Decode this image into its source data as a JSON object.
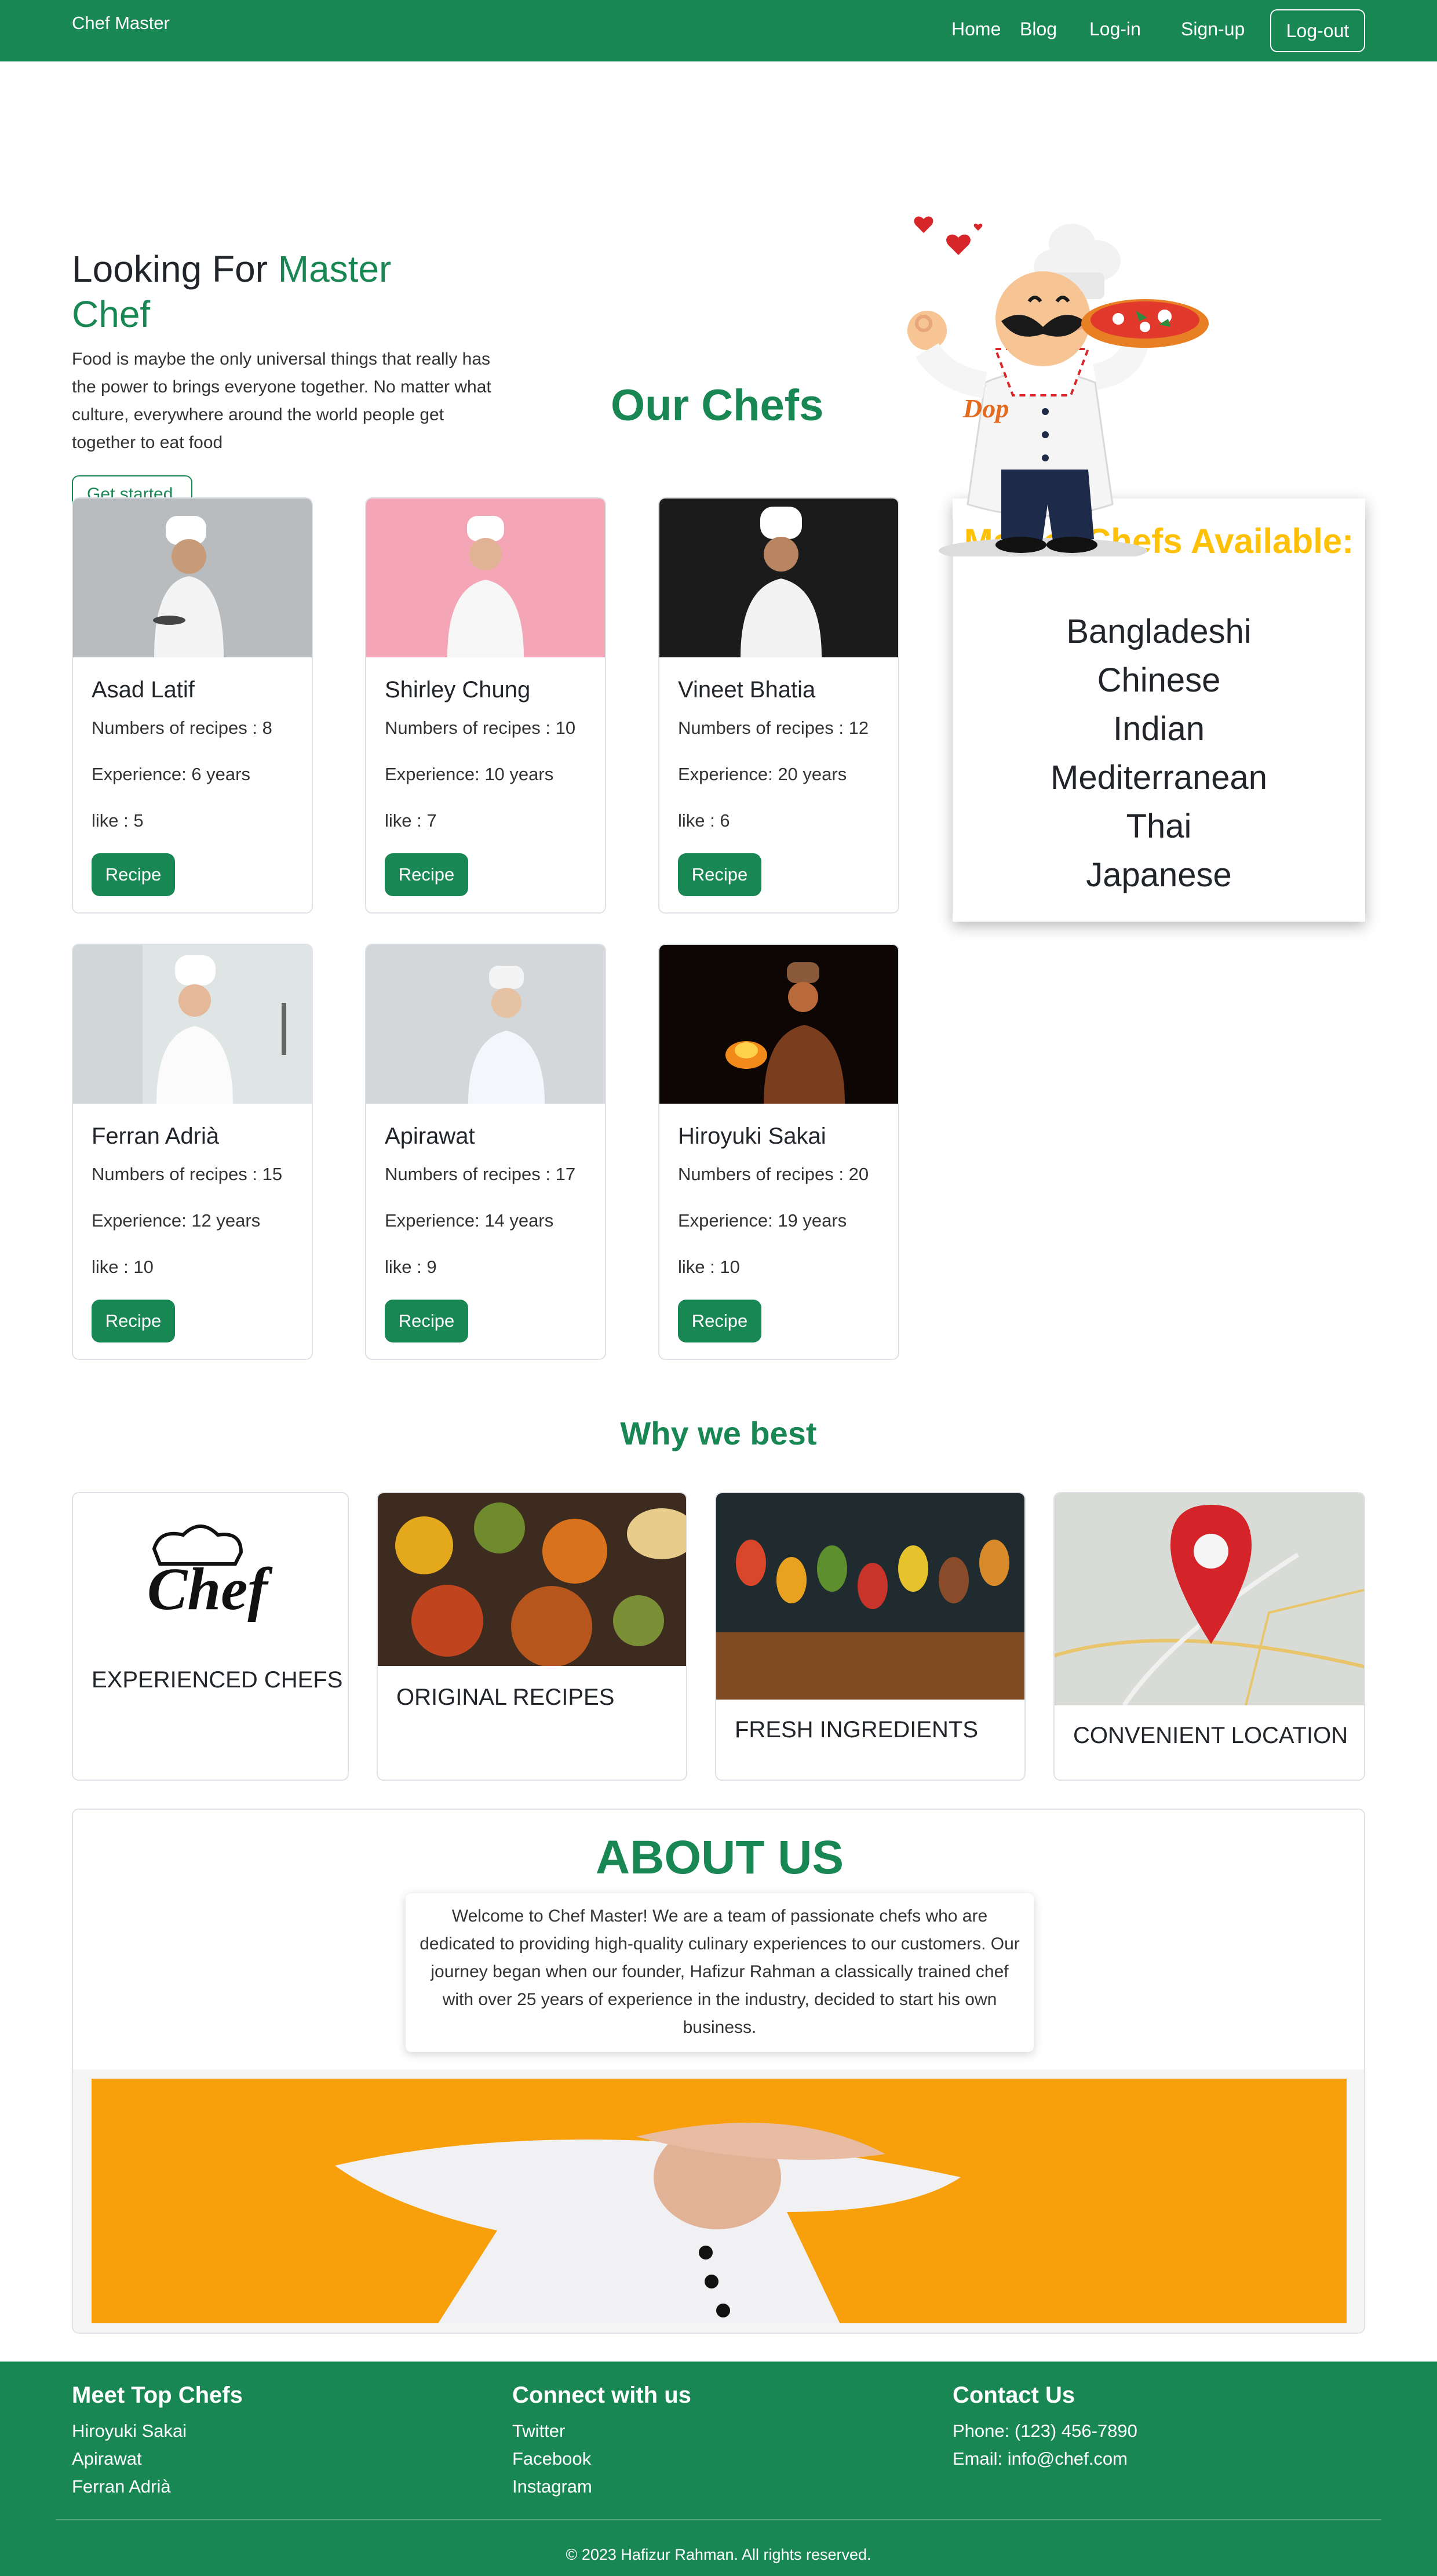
{
  "navbar": {
    "brand": "Chef Master",
    "links": [
      "Home",
      "Blog",
      "Log-in",
      "Sign-up"
    ],
    "logout": "Log-out"
  },
  "hero": {
    "title_plain": "Looking For ",
    "title_accent": "Master Chef",
    "text": "Food is maybe the only universal things that really has the power to brings everyone together. No matter what culture, everywhere around the world people get together to eat food",
    "cta": "Get started"
  },
  "chefs_section": {
    "title": "Our Chefs",
    "chefs": [
      {
        "name": "Asad Latif",
        "recipes": "Numbers of recipes : 8",
        "experience": "Experience: 6 years",
        "likes": "like : 5",
        "button": "Recipe"
      },
      {
        "name": "Shirley Chung",
        "recipes": "Numbers of recipes : 10",
        "experience": "Experience: 10 years",
        "likes": "like : 7",
        "button": "Recipe"
      },
      {
        "name": "Vineet Bhatia",
        "recipes": "Numbers of recipes : 12",
        "experience": "Experience: 20 years",
        "likes": "like : 6",
        "button": "Recipe"
      },
      {
        "name": "Ferran Adrià",
        "recipes": "Numbers of recipes : 15",
        "experience": "Experience: 12 years",
        "likes": "like : 10",
        "button": "Recipe"
      },
      {
        "name": "Apirawat",
        "recipes": "Numbers of recipes : 17",
        "experience": "Experience: 14 years",
        "likes": "like : 9",
        "button": "Recipe"
      },
      {
        "name": "Hiroyuki Sakai",
        "recipes": "Numbers of recipes : 20",
        "experience": "Experience: 19 years",
        "likes": "like : 10",
        "button": "Recipe"
      }
    ]
  },
  "masters_panel": {
    "title": "Master Chefs Available:",
    "cuisines": [
      "Bangladeshi",
      "Chinese",
      "Indian",
      "Mediterranean",
      "Thai",
      "Japanese"
    ]
  },
  "why_section": {
    "title": "Why we best",
    "cards": [
      {
        "label": "EXPERIENCED CHEFS",
        "logo_text": "Chef"
      },
      {
        "label": "ORIGINAL RECIPES"
      },
      {
        "label": "FRESH INGREDIENTS"
      },
      {
        "label": "CONVENIENT LOCATION"
      }
    ]
  },
  "about": {
    "title": "ABOUT US",
    "text": "Welcome to Chef Master! We are a team of passionate chefs who are dedicated to providing high-quality culinary experiences to our customers. Our journey began when our founder, Hafizur Rahman a classically trained chef with over 25 years of experience in the industry, decided to start his own business."
  },
  "footer": {
    "col1": {
      "heading": "Meet Top Chefs",
      "items": [
        "Hiroyuki Sakai",
        "Apirawat",
        "Ferran Adrià"
      ]
    },
    "col2": {
      "heading": "Connect with us",
      "items": [
        "Twitter",
        "Facebook",
        "Instagram"
      ]
    },
    "col3": {
      "heading": "Contact Us",
      "items": [
        "Phone: (123) 456-7890",
        "Email: info@chef.com"
      ]
    },
    "copyright": "© 2023 Hafizur Rahman. All rights reserved."
  },
  "colors": {
    "primary": "#198754",
    "accent_yellow": "#ffc107",
    "about_orange": "#f7a00c"
  }
}
